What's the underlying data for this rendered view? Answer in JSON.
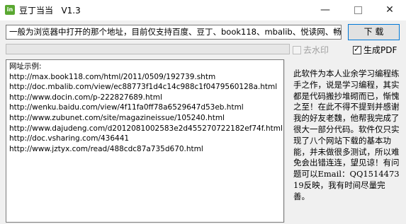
{
  "window": {
    "title": "豆丁当当   V1.3",
    "icon_text": "in",
    "controls": {
      "minimize": "—",
      "close": "✕"
    }
  },
  "toolbar": {
    "url_value": "一般为浏览器中打开的那个地址，目前仅支持百度、豆丁、book118、mbalib、悦读网、畅",
    "download_label": "下 载"
  },
  "progress": {
    "value": 0
  },
  "options": {
    "watermark_label": "去水印",
    "watermark_checked": false,
    "watermark_enabled": false,
    "pdf_label": "生成PDF",
    "pdf_checked": true,
    "pdf_check_glyph": "✓"
  },
  "examples": {
    "header": "网址示例:",
    "urls": [
      "http://max.book118.com/html/2011/0509/192739.shtm",
      "http://doc.mbalib.com/view/ec88773f1d4c14c988c1f0479560128a.html",
      "http://www.docin.com/p-222827689.html",
      "http://wenku.baidu.com/view/4f11fa0ff78a6529647d53eb.html",
      "http://www.zubunet.com/site/magazineissue/105240.html",
      "http://www.dajudeng.com/d2012081002583e2d455270722182ef74f.html",
      "http://doc.vsharing.com/436441",
      "http://www.jztyx.com/read/488cdc87a735d670.html"
    ]
  },
  "note": "此软件为本人业余学习编程练手之作，说是学习编程，其实都是代码搬抄堆砌而已，惭愧之至！在此不得不提到并感谢我的好友老魏，他帮我完成了很大一部分代码。软件仅只实现了八个网站下载的基本功能，并未做很多测试，所以难免会出错连连，望见谅！有问题可以Email：QQ151447319反映，我有时间尽量完善。",
  "colors": {
    "accent": "#0078d7",
    "progress_fill": "#06b025",
    "icon_green": "#5aa832"
  }
}
